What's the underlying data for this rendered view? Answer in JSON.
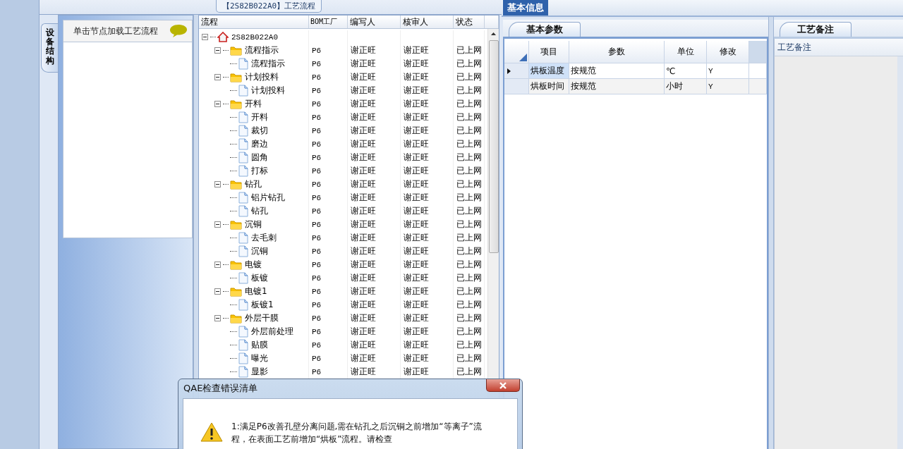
{
  "process_tab": {
    "title": "【2S82B022A0】工艺流程"
  },
  "side_tab": {
    "label": "设备结构",
    "selected": true
  },
  "hint_panel": {
    "text": "单击节点加载工艺流程"
  },
  "tree_grid": {
    "columns": [
      "流程",
      "BOM工厂",
      "编写人",
      "核审人",
      "状态"
    ],
    "root": {
      "kind": "root",
      "name": "2S82B022A0",
      "expanded": true,
      "children": [
        {
          "kind": "folder",
          "name": "流程指示",
          "bom": "P6",
          "author": "谢正旺",
          "reviewer": "谢正旺",
          "status": "已上网",
          "expanded": true,
          "children": [
            {
              "kind": "step",
              "name": "流程指示",
              "bom": "P6",
              "author": "谢正旺",
              "reviewer": "谢正旺",
              "status": "已上网"
            }
          ]
        },
        {
          "kind": "folder",
          "name": "计划投料",
          "bom": "P6",
          "author": "谢正旺",
          "reviewer": "谢正旺",
          "status": "已上网",
          "expanded": true,
          "children": [
            {
              "kind": "step",
              "name": "计划投料",
              "bom": "P6",
              "author": "谢正旺",
              "reviewer": "谢正旺",
              "status": "已上网"
            }
          ]
        },
        {
          "kind": "folder",
          "name": "开料",
          "bom": "P6",
          "author": "谢正旺",
          "reviewer": "谢正旺",
          "status": "已上网",
          "expanded": true,
          "children": [
            {
              "kind": "step",
              "name": "开料",
              "bom": "P6",
              "author": "谢正旺",
              "reviewer": "谢正旺",
              "status": "已上网"
            },
            {
              "kind": "step",
              "name": "裁切",
              "bom": "P6",
              "author": "谢正旺",
              "reviewer": "谢正旺",
              "status": "已上网"
            },
            {
              "kind": "step",
              "name": "磨边",
              "bom": "P6",
              "author": "谢正旺",
              "reviewer": "谢正旺",
              "status": "已上网"
            },
            {
              "kind": "step",
              "name": "圆角",
              "bom": "P6",
              "author": "谢正旺",
              "reviewer": "谢正旺",
              "status": "已上网"
            },
            {
              "kind": "step",
              "name": "打标",
              "bom": "P6",
              "author": "谢正旺",
              "reviewer": "谢正旺",
              "status": "已上网"
            }
          ]
        },
        {
          "kind": "folder",
          "name": "钻孔",
          "bom": "P6",
          "author": "谢正旺",
          "reviewer": "谢正旺",
          "status": "已上网",
          "expanded": true,
          "children": [
            {
              "kind": "step",
              "name": "铝片钻孔",
              "bom": "P6",
              "author": "谢正旺",
              "reviewer": "谢正旺",
              "status": "已上网"
            },
            {
              "kind": "step",
              "name": "钻孔",
              "bom": "P6",
              "author": "谢正旺",
              "reviewer": "谢正旺",
              "status": "已上网"
            }
          ]
        },
        {
          "kind": "folder",
          "name": "沉铜",
          "bom": "P6",
          "author": "谢正旺",
          "reviewer": "谢正旺",
          "status": "已上网",
          "expanded": true,
          "children": [
            {
              "kind": "step",
              "name": "去毛刺",
              "bom": "P6",
              "author": "谢正旺",
              "reviewer": "谢正旺",
              "status": "已上网"
            },
            {
              "kind": "step",
              "name": "沉铜",
              "bom": "P6",
              "author": "谢正旺",
              "reviewer": "谢正旺",
              "status": "已上网"
            }
          ]
        },
        {
          "kind": "folder",
          "name": "电镀",
          "bom": "P6",
          "author": "谢正旺",
          "reviewer": "谢正旺",
          "status": "已上网",
          "expanded": true,
          "children": [
            {
              "kind": "step",
              "name": "板镀",
              "bom": "P6",
              "author": "谢正旺",
              "reviewer": "谢正旺",
              "status": "已上网"
            }
          ]
        },
        {
          "kind": "folder",
          "name": "电镀1",
          "bom": "P6",
          "author": "谢正旺",
          "reviewer": "谢正旺",
          "status": "已上网",
          "expanded": true,
          "children": [
            {
              "kind": "step",
              "name": "板镀1",
              "bom": "P6",
              "author": "谢正旺",
              "reviewer": "谢正旺",
              "status": "已上网"
            }
          ]
        },
        {
          "kind": "folder",
          "name": "外层干膜",
          "bom": "P6",
          "author": "谢正旺",
          "reviewer": "谢正旺",
          "status": "已上网",
          "expanded": true,
          "children": [
            {
              "kind": "step",
              "name": "外层前处理",
              "bom": "P6",
              "author": "谢正旺",
              "reviewer": "谢正旺",
              "status": "已上网"
            },
            {
              "kind": "step",
              "name": "贴膜",
              "bom": "P6",
              "author": "谢正旺",
              "reviewer": "谢正旺",
              "status": "已上网"
            },
            {
              "kind": "step",
              "name": "曝光",
              "bom": "P6",
              "author": "谢正旺",
              "reviewer": "谢正旺",
              "status": "已上网"
            },
            {
              "kind": "step",
              "name": "显影",
              "bom": "P6",
              "author": "谢正旺",
              "reviewer": "谢正旺",
              "status": "已上网"
            }
          ]
        }
      ]
    }
  },
  "top_tabs": [
    {
      "label": "基本信息",
      "selected": true
    }
  ],
  "param_panel": {
    "tabs": [
      {
        "label": "基本参数",
        "selected": true
      }
    ],
    "columns": [
      "项目",
      "参数",
      "单位",
      "修改"
    ],
    "rows": [
      {
        "selected": true,
        "cells": [
          "烘板温度",
          "按规范",
          "℃",
          "Y"
        ]
      },
      {
        "selected": false,
        "cells": [
          "烘板时间",
          "按规范",
          "小时",
          "Y"
        ]
      }
    ]
  },
  "note_panel": {
    "tabs": [
      {
        "label": "工艺备注",
        "selected": true
      }
    ],
    "header": "工艺备注"
  },
  "dialog": {
    "title": "QAE检查错误清单",
    "message": "1:满足P6改善孔壁分离问题,需在钻孔之后沉铜之前增加“等离子”流程，在表面工艺前增加“烘板”流程。请检查"
  }
}
